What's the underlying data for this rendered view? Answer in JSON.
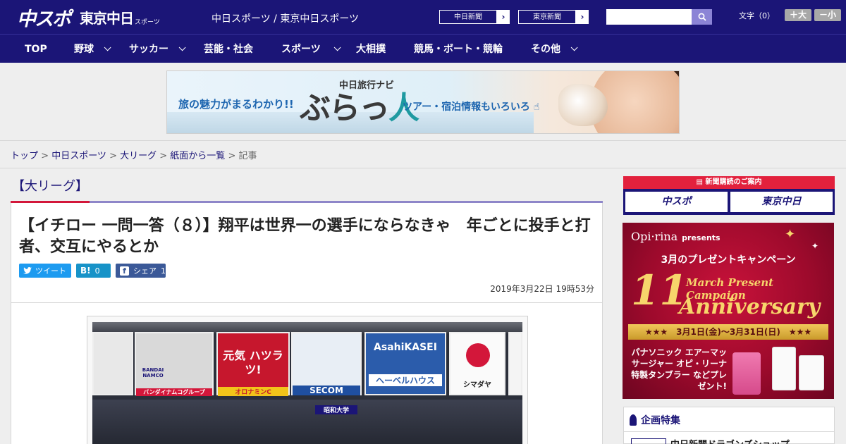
{
  "header": {
    "logo_main": "中スポ",
    "logo_sub": "東京中日",
    "logo_small": "スポーツ",
    "site_links": "中日スポーツ / 東京中日スポーツ",
    "pill_1": "中日新聞",
    "pill_2": "東京新聞",
    "search_placeholder": "",
    "font_label": "文字（0）",
    "font_plus": "＋大",
    "font_minus": "－小"
  },
  "nav": {
    "items": [
      {
        "label": "TOP"
      },
      {
        "label": "野球"
      },
      {
        "label": "サッカー"
      },
      {
        "label": "芸能・社会"
      },
      {
        "label": "スポーツ"
      },
      {
        "label": "大相撲"
      },
      {
        "label": "競馬・ボート・競輪"
      },
      {
        "label": "その他"
      }
    ]
  },
  "banner": {
    "left_text": "旅の魅力がまるわかり!!",
    "navi": "中日旅行ナビ",
    "big_a": "ぶらっ",
    "big_b": "人",
    "right_text": "ツアー・宿泊情報もいろいろ"
  },
  "breadcrumb": {
    "items": [
      "トップ",
      "中日スポーツ",
      "大リーグ",
      "紙面から一覧"
    ],
    "current": "記事"
  },
  "article": {
    "category": "【大リーグ】",
    "title": "【イチロー 一問一答（８）】翔平は世界一の選手にならなきゃ　年ごとに投手と打者、交互にやるとか",
    "tweet": "ツイート",
    "hatena_count": "0",
    "share_label": "シェア",
    "share_count": "1",
    "date": "2019年3月22日 19時53分"
  },
  "photo": {
    "b1": "BANDAI NAMCO",
    "b1b": "バンダイナムコグループ",
    "b2": "元気 ハツラツ!",
    "b2b": "オロナミンC",
    "b3": "SECOM",
    "b4": "AsahiKASEI",
    "b4b": "ヘーベルハウス",
    "b5": "シマダヤ",
    "b6": "昭和大学"
  },
  "sidebar": {
    "sub_top": "新聞購読のご案内",
    "sub_box1": "中スポ",
    "sub_box2": "東京中日",
    "ad_brand": "Opi·rina",
    "ad_presents": "presents",
    "ad_camp": "3月のプレゼントキャンペーン",
    "ad_num": "11",
    "ad_march": "March Present Campaign",
    "ad_anniv": "Anniversary",
    "ad_dates": "★★★　3月1日(金)〜3月31日(日)　★★★",
    "ad_prize": "パナソニック エアーマッサージャー オピ・リーナ特製タンブラー などプレゼント!",
    "feat_title": "企画特集",
    "feat_link": "中日新聞ドラゴンズショップ"
  },
  "colors": {
    "brand_navy": "#1b1577",
    "accent_red": "#d3173a",
    "share_blue": "#1d9bf0",
    "fb_blue": "#3b5998"
  }
}
